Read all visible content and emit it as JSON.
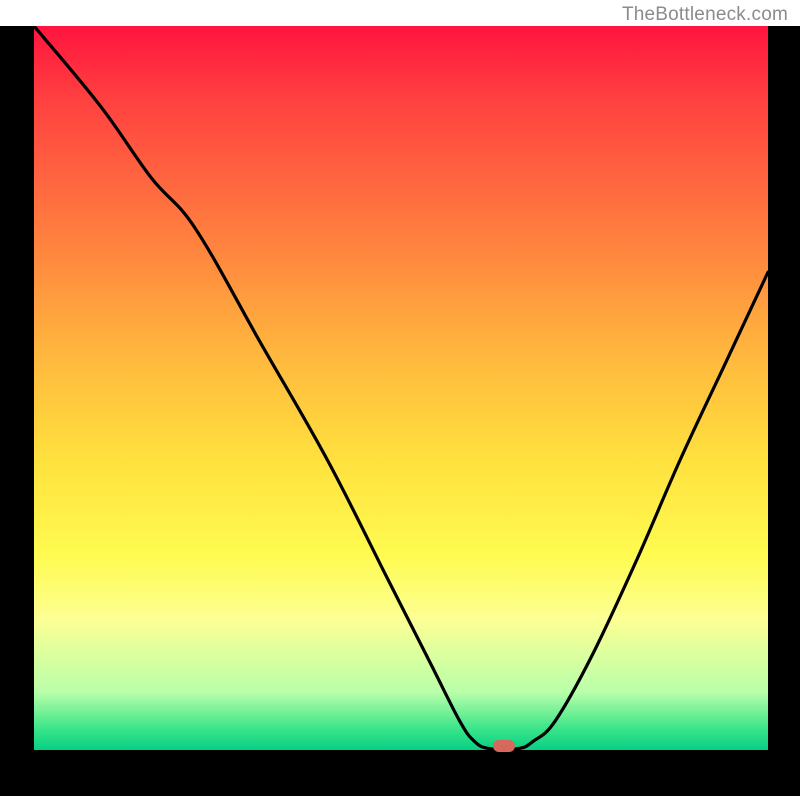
{
  "watermark": "TheBottleneck.com",
  "chart_data": {
    "type": "line",
    "title": "",
    "xlabel": "",
    "ylabel": "",
    "xlim": [
      0,
      100
    ],
    "ylim": [
      0,
      100
    ],
    "curve": {
      "x": [
        0,
        9,
        16,
        22,
        31,
        40,
        48,
        54,
        58,
        60,
        62,
        66,
        68,
        71,
        76,
        82,
        88,
        94,
        100
      ],
      "y": [
        100,
        89,
        79,
        72,
        56,
        40,
        24,
        12,
        4,
        1.2,
        0.2,
        0.2,
        1.2,
        4,
        13,
        26,
        40,
        53,
        66
      ]
    },
    "marker": {
      "x": 64,
      "y": 0.6
    },
    "background_gradient": {
      "top": "#ff143e",
      "bottom": "#07d084"
    }
  }
}
